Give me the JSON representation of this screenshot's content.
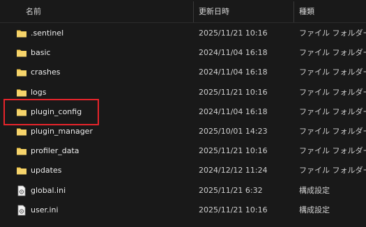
{
  "columns": {
    "name": "名前",
    "modified": "更新日時",
    "type": "種類"
  },
  "files": [
    {
      "name": ".sentinel",
      "modified": "2025/11/21 10:16",
      "type": "ファイル フォルダー",
      "icon": "folder-icon"
    },
    {
      "name": "basic",
      "modified": "2024/11/04 16:18",
      "type": "ファイル フォルダー",
      "icon": "folder-icon"
    },
    {
      "name": "crashes",
      "modified": "2024/11/04 16:18",
      "type": "ファイル フォルダー",
      "icon": "folder-icon"
    },
    {
      "name": "logs",
      "modified": "2025/11/21 10:16",
      "type": "ファイル フォルダー",
      "icon": "folder-icon"
    },
    {
      "name": "plugin_config",
      "modified": "2024/11/04 16:18",
      "type": "ファイル フォルダー",
      "icon": "folder-icon"
    },
    {
      "name": "plugin_manager",
      "modified": "2025/10/01 14:23",
      "type": "ファイル フォルダー",
      "icon": "folder-icon"
    },
    {
      "name": "profiler_data",
      "modified": "2025/11/21 10:16",
      "type": "ファイル フォルダー",
      "icon": "folder-icon"
    },
    {
      "name": "updates",
      "modified": "2024/12/12 11:24",
      "type": "ファイル フォルダー",
      "icon": "folder-icon"
    },
    {
      "name": "global.ini",
      "modified": "2025/11/21 6:32",
      "type": "構成設定",
      "icon": "ini-file-icon"
    },
    {
      "name": "user.ini",
      "modified": "2025/11/21 10:16",
      "type": "構成設定",
      "icon": "ini-file-icon"
    }
  ],
  "colors": {
    "background": "#191919",
    "folder": "#f2c94c",
    "highlight": "#e8242b"
  }
}
